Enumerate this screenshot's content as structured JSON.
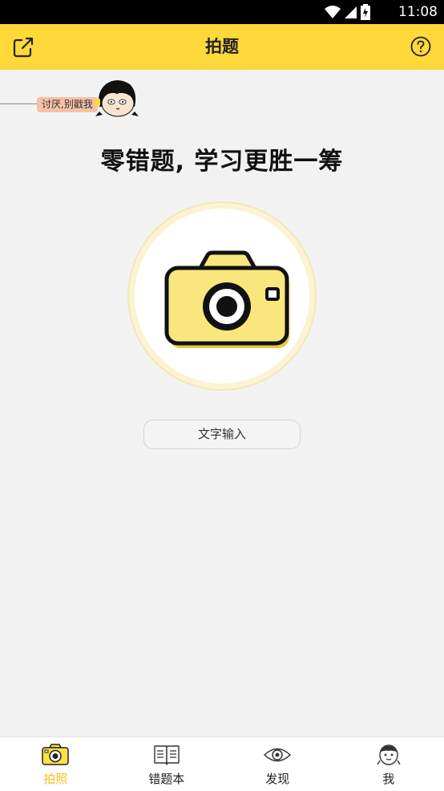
{
  "status_bar": {
    "time": "11:08",
    "icons": [
      "wifi-icon",
      "signal-icon",
      "battery-icon"
    ]
  },
  "header": {
    "title": "拍题",
    "left_icon": "share-icon",
    "right_icon": "help-icon"
  },
  "mascot": {
    "bubble_text": "讨厌,别戳我"
  },
  "main": {
    "slogan": "零错题, 学习更胜一筹",
    "text_input_label": "文字输入",
    "camera_icon": "camera-icon"
  },
  "nav": {
    "items": [
      {
        "label": "拍照",
        "icon": "camera-icon",
        "active": true
      },
      {
        "label": "错题本",
        "icon": "book-icon",
        "active": false
      },
      {
        "label": "发现",
        "icon": "eye-icon",
        "active": false
      },
      {
        "label": "我",
        "icon": "profile-icon",
        "active": false
      }
    ]
  },
  "colors": {
    "brand_yellow": "#ffd83a",
    "camera_yellow": "#f9e77e",
    "active_nav": "#f2c31c",
    "background": "#f2f2f2"
  }
}
